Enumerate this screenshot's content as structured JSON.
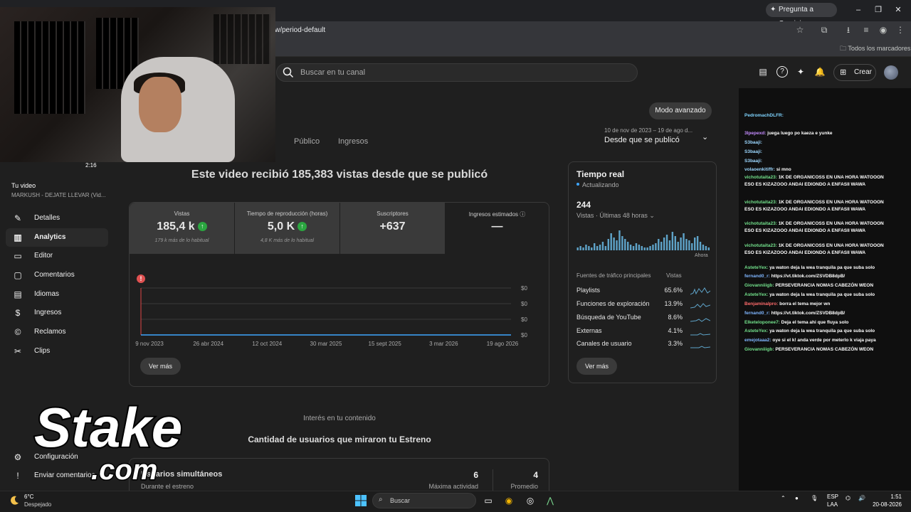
{
  "browser": {
    "gemini_label": "Pregunta a Gemini",
    "url": "w/period-default",
    "bookmarks_label": "Todos los marcadores"
  },
  "header": {
    "search_placeholder": "Buscar en tu canal",
    "create_label": "Crear"
  },
  "sidebar": {
    "thumb_time": "2:16",
    "your_video": "Tu video",
    "video_title": "MARKUSH - DEJATE LLEVAR (Vid...",
    "items": [
      {
        "label": "Detalles",
        "icon": "pencil-icon"
      },
      {
        "label": "Analytics",
        "icon": "analytics-icon"
      },
      {
        "label": "Editor",
        "icon": "editor-icon"
      },
      {
        "label": "Comentarios",
        "icon": "comment-icon"
      },
      {
        "label": "Idiomas",
        "icon": "subtitles-icon"
      },
      {
        "label": "Ingresos",
        "icon": "dollar-icon"
      },
      {
        "label": "Reclamos",
        "icon": "copyright-icon"
      },
      {
        "label": "Clips",
        "icon": "scissors-icon"
      }
    ],
    "settings_label": "Configuración",
    "feedback_label": "Enviar comentarios"
  },
  "analytics": {
    "advanced_mode": "Modo avanzado",
    "tabs": [
      "Público",
      "Ingresos"
    ],
    "range_dates": "10 de nov de 2023 – 19 de ago d...",
    "range_label": "Desde que se publicó",
    "headline": "Este video recibió 185,383 vistas desde que se publicó",
    "metrics": [
      {
        "label": "Vistas",
        "value": "185,4 k",
        "sub": "179 k más de lo habitual",
        "up": true
      },
      {
        "label": "Tiempo de reproducción (horas)",
        "value": "5,0 K",
        "sub": "4,8 K más de lo habitual",
        "up": true
      },
      {
        "label": "Suscriptores",
        "value": "+637",
        "sub": "",
        "up": false
      },
      {
        "label": "Ingresos estimados",
        "value": "—",
        "sub": "",
        "up": false
      }
    ],
    "error_mark": "!",
    "see_more": "Ver más"
  },
  "chart_data": {
    "type": "line",
    "x_tick_labels": [
      "9 nov 2023",
      "26 abr 2024",
      "12 oct 2024",
      "30 mar 2025",
      "15 sept 2025",
      "3 mar 2026",
      "19 ago 2026"
    ],
    "y_tick_labels": [
      "$0",
      "$0",
      "$0",
      "$0"
    ],
    "series": [
      {
        "values": [
          0,
          0,
          0,
          0,
          0,
          0,
          0
        ]
      }
    ]
  },
  "realtime": {
    "title": "Tiempo real",
    "updating": "Actualizando",
    "count": "244",
    "subtitle": "Vistas · Últimas 48 horas",
    "now_label": "Ahora",
    "bars": [
      2,
      3,
      2,
      4,
      3,
      2,
      5,
      3,
      4,
      6,
      3,
      8,
      12,
      9,
      7,
      14,
      10,
      8,
      6,
      4,
      3,
      5,
      4,
      3,
      2,
      2,
      3,
      4,
      5,
      8,
      6,
      9,
      11,
      7,
      13,
      10,
      6,
      9,
      12,
      8,
      7,
      5,
      9,
      10,
      6,
      4,
      3,
      2
    ],
    "sources_header": "Fuentes de tráfico principales",
    "views_header": "Vistas",
    "sources": [
      {
        "name": "Playlists",
        "pct": "65.6%"
      },
      {
        "name": "Funciones de exploración",
        "pct": "13.9%"
      },
      {
        "name": "Búsqueda de YouTube",
        "pct": "8.6%"
      },
      {
        "name": "Externas",
        "pct": "4.1%"
      },
      {
        "name": "Canales de usuario",
        "pct": "3.3%"
      }
    ],
    "see_more": "Ver más"
  },
  "engagement": {
    "interest": "Interés en tu contenido",
    "premiere_title": "Cantidad de usuarios que miraron tu Estreno",
    "concurrent_label": "Usuarios simultáneos",
    "concurrent_sub": "Durante el estreno",
    "max_value": "6",
    "max_label": "Máxima actividad",
    "avg_value": "4",
    "avg_label": "Promedio"
  },
  "overlay": {
    "brand_text": "Stake",
    "brand_suffix": ".com"
  },
  "chat": [
    {
      "user": "PedromachDLFR:",
      "msg": "",
      "color": "#7fd4ff"
    },
    {
      "user": "3lpepexd:",
      "msg": "juega luego po kaeza e yunke",
      "color": "#c58cff"
    },
    {
      "user": "S3baaji:",
      "msg": "",
      "color": "#9bd7ff"
    },
    {
      "user": "S3baaji:",
      "msg": "",
      "color": "#9bd7ff"
    },
    {
      "user": "S3baaji:",
      "msg": "",
      "color": "#9bd7ff"
    },
    {
      "user": "volaoenkitiffr:",
      "msg": "si mno",
      "color": "#9bd7ff"
    },
    {
      "user": "vichotutaita23:",
      "msg": "1K DE ORGANICOSS EN UNA HORA WATOOON ESO ES KIZAZOOO ANDAI EDIONDO A ENFASII WAWA",
      "color": "#73e28c"
    },
    {
      "user": "vichotutaita23:",
      "msg": "1K DE ORGANICOSS EN UNA HORA WATOOON ESO ES KIZAZOOO ANDAI EDIONDO A ENFASII WAWA",
      "color": "#73e28c"
    },
    {
      "user": "vichotutaita23:",
      "msg": "1K DE ORGANICOSS EN UNA HORA WATOOON ESO ES KIZAZOOO ANDAI EDIONDO A ENFASII WAWA",
      "color": "#73e28c"
    },
    {
      "user": "vichotutaita23:",
      "msg": "1K DE ORGANICOSS EN UNA HORA WATOOON ESO ES KIZAZOOO ANDAI EDIONDO A ENFASII WAWA",
      "color": "#73e28c"
    },
    {
      "user": "AsteteYex:",
      "msg": "ya waton deja la wea tranquila pa que suba solo",
      "color": "#73e28c"
    },
    {
      "user": "fernand0_r:",
      "msg": "https://vt.tiktok.com/ZSVDB8dpB/",
      "color": "#7fb6ff"
    },
    {
      "user": "Giovanniiigb:",
      "msg": "PERSEVERANCIA NOMAS CABEZÓN WEON",
      "color": "#73e28c"
    },
    {
      "user": "AsteteYex:",
      "msg": "ya waton deja la wea tranquila pa que suba solo",
      "color": "#73e28c"
    },
    {
      "user": "Benjaminalpro:",
      "msg": "borra el tema mejor wn",
      "color": "#ff6b6b"
    },
    {
      "user": "fernand0_r:",
      "msg": "https://vt.tiktok.com/ZSVDB8dpB/",
      "color": "#7fb6ff"
    },
    {
      "user": "Elketeloponee7:",
      "msg": "Deja el tema ahi que fluya solo",
      "color": "#73e28c"
    },
    {
      "user": "AsteteYex:",
      "msg": "ya waton deja la wea tranquila pa que suba solo",
      "color": "#73e28c"
    },
    {
      "user": "emejotaaa2:",
      "msg": "oye si el k! anda verde por meterlo k viaja paya",
      "color": "#7fb6ff"
    },
    {
      "user": "Giovanniiigb:",
      "msg": "PERSEVERANCIA NOMAS CABEZÓN WEON",
      "color": "#73e28c"
    }
  ],
  "taskbar": {
    "temp": "6°C",
    "condition": "Despejado",
    "search_label": "Buscar",
    "lang1": "ESP",
    "lang2": "LAA",
    "time": "1:51",
    "date": "20-08-2026"
  },
  "colors": {
    "accent_green": "#2ba640",
    "chart_line": "#3ea6ff",
    "error_red": "#e05151"
  }
}
